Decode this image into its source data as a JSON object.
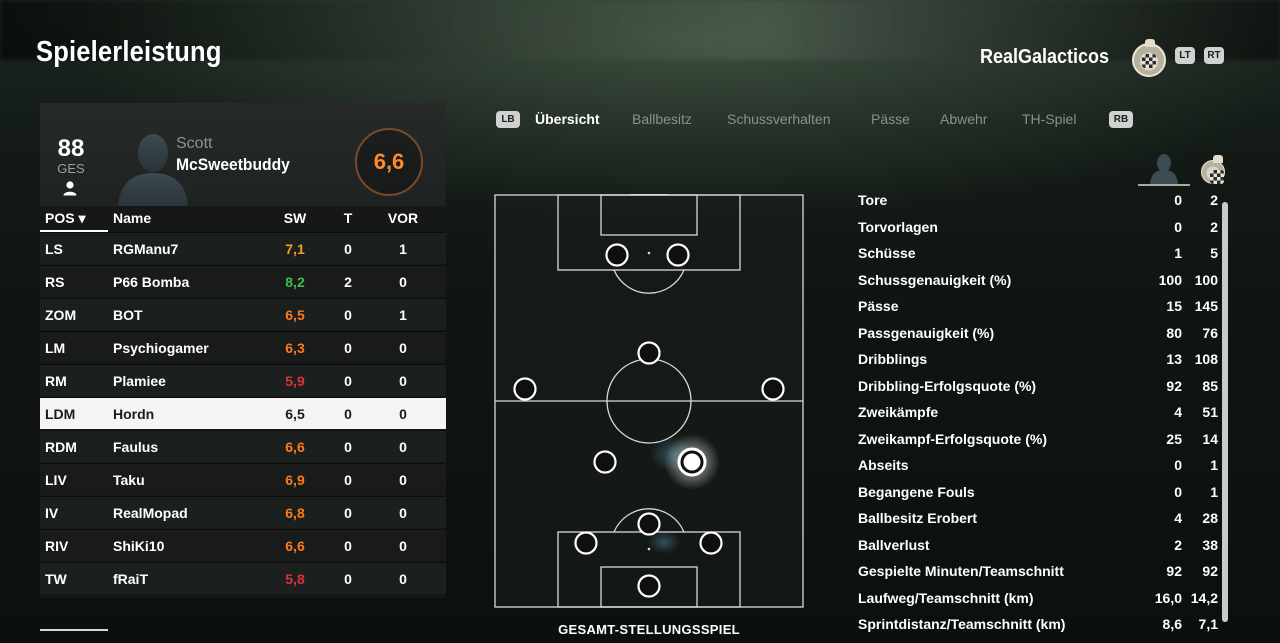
{
  "header": {
    "title": "Spielerleistung",
    "team_name": "RealGalacticos",
    "lt_hint": "LT",
    "rt_hint": "RT"
  },
  "player": {
    "rating_overall": "88",
    "rating_label": "GES",
    "first_name": "Scott",
    "last_name": "McSweetbuddy",
    "match_rating": "6,6",
    "match_rating_color": "#ff8a2a"
  },
  "roster": {
    "headers": {
      "pos": "POS ▾",
      "name": "Name",
      "sw": "SW",
      "t": "T",
      "vor": "VOR"
    },
    "selected_index": 5,
    "rows": [
      {
        "pos": "LS",
        "name": "RGManu7",
        "sw": "7,1",
        "sw_color": "#f0a020",
        "t": "0",
        "vor": "1"
      },
      {
        "pos": "RS",
        "name": "P66 Bomba",
        "sw": "8,2",
        "sw_color": "#3fbf4a",
        "t": "2",
        "vor": "0"
      },
      {
        "pos": "ZOM",
        "name": "BOT",
        "sw": "6,5",
        "sw_color": "#ff7a1a",
        "t": "0",
        "vor": "1"
      },
      {
        "pos": "LM",
        "name": "Psychiogamer",
        "sw": "6,3",
        "sw_color": "#ff7a1a",
        "t": "0",
        "vor": "0"
      },
      {
        "pos": "RM",
        "name": "Plamiee",
        "sw": "5,9",
        "sw_color": "#e0303a",
        "t": "0",
        "vor": "0"
      },
      {
        "pos": "LDM",
        "name": "Hordn",
        "sw": "6,5",
        "sw_color": "#1a1a1a",
        "t": "0",
        "vor": "0"
      },
      {
        "pos": "RDM",
        "name": "Faulus",
        "sw": "6,6",
        "sw_color": "#ff7a1a",
        "t": "0",
        "vor": "0"
      },
      {
        "pos": "LIV",
        "name": "Taku",
        "sw": "6,9",
        "sw_color": "#ff7a1a",
        "t": "0",
        "vor": "0"
      },
      {
        "pos": "IV",
        "name": "RealMopad",
        "sw": "6,8",
        "sw_color": "#ff7a1a",
        "t": "0",
        "vor": "0"
      },
      {
        "pos": "RIV",
        "name": "ShiKi10",
        "sw": "6,6",
        "sw_color": "#ff7a1a",
        "t": "0",
        "vor": "0"
      },
      {
        "pos": "TW",
        "name": "fRaiT",
        "sw": "5,8",
        "sw_color": "#e0303a",
        "t": "0",
        "vor": "0"
      }
    ]
  },
  "tabs": {
    "lb_hint": "LB",
    "rb_hint": "RB",
    "items": [
      "Übersicht",
      "Ballbesitz",
      "Schussverhalten",
      "Pässe",
      "Abwehr",
      "TH-Spiel"
    ],
    "active_index": 0
  },
  "pitch": {
    "caption": "GESAMT-STELLUNGSSPIEL"
  },
  "stats": {
    "rows": [
      {
        "label": "Tore",
        "player": "0",
        "team": "2"
      },
      {
        "label": "Torvorlagen",
        "player": "0",
        "team": "2"
      },
      {
        "label": "Schüsse",
        "player": "1",
        "team": "5"
      },
      {
        "label": "Schussgenauigkeit (%)",
        "player": "100",
        "team": "100"
      },
      {
        "label": "Pässe",
        "player": "15",
        "team": "145"
      },
      {
        "label": "Passgenauigkeit (%)",
        "player": "80",
        "team": "76"
      },
      {
        "label": "Dribblings",
        "player": "13",
        "team": "108"
      },
      {
        "label": "Dribbling-Erfolgsquote (%)",
        "player": "92",
        "team": "85"
      },
      {
        "label": "Zweikämpfe",
        "player": "4",
        "team": "51"
      },
      {
        "label": "Zweikampf-Erfolgsquote (%)",
        "player": "25",
        "team": "14"
      },
      {
        "label": "Abseits",
        "player": "0",
        "team": "1"
      },
      {
        "label": "Begangene Fouls",
        "player": "0",
        "team": "1"
      },
      {
        "label": "Ballbesitz Erobert",
        "player": "4",
        "team": "28"
      },
      {
        "label": "Ballverlust",
        "player": "2",
        "team": "38"
      },
      {
        "label": "Gespielte Minuten/Teamschnitt",
        "player": "92",
        "team": "92"
      },
      {
        "label": "Laufweg/Teamschnitt (km)",
        "player": "16,0",
        "team": "14,2"
      },
      {
        "label": "Sprintdistanz/Teamschnitt (km)",
        "player": "8,6",
        "team": "7,1"
      }
    ]
  }
}
